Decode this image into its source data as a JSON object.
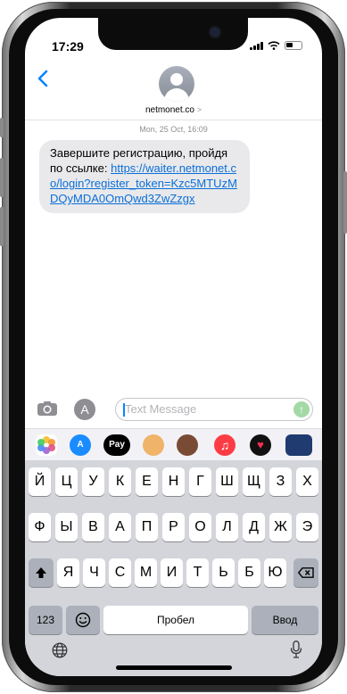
{
  "status_bar": {
    "time": "17:29"
  },
  "header": {
    "contact_name": "netmonet.co",
    "contact_chevron": ">",
    "back_icon": "chevron-left-icon"
  },
  "thread": {
    "date": "Mon, 25 Oct, 16:09",
    "message_text": "Завершите регистрацию, пройдя по ссылке: ",
    "message_link": "https://waiter.netmonet.co/login?register_token=Kzc5MTUzMDQyMDA0OmQwd3ZwZzgx"
  },
  "composer": {
    "placeholder": "Text Message",
    "camera_icon": "camera-icon",
    "apps_icon": "app-store-icon",
    "send_icon": "arrow-up-icon"
  },
  "app_drawer": {
    "apps": [
      {
        "name": "photos-icon",
        "label": "",
        "color": "#ffffff"
      },
      {
        "name": "app-store-icon",
        "label": "A",
        "color": "#1a8cff"
      },
      {
        "name": "apple-pay-icon",
        "label": "Pay",
        "color": "#000000"
      },
      {
        "name": "memoji-icon",
        "label": "",
        "color": "#f2a65a"
      },
      {
        "name": "animoji-icon",
        "label": "",
        "color": "#8b5a3c"
      },
      {
        "name": "music-icon",
        "label": "♫",
        "color": "#fc3c44"
      },
      {
        "name": "digital-touch-icon",
        "label": "♥",
        "color": "#111111"
      },
      {
        "name": "more-apps-icon",
        "label": "",
        "color": "#1f3b70"
      }
    ]
  },
  "keyboard": {
    "row1": [
      "Й",
      "Ц",
      "У",
      "К",
      "Е",
      "Н",
      "Г",
      "Ш",
      "Щ",
      "З",
      "Х"
    ],
    "row2": [
      "Ф",
      "Ы",
      "В",
      "А",
      "П",
      "Р",
      "О",
      "Л",
      "Д",
      "Ж",
      "Э"
    ],
    "row3": [
      "Я",
      "Ч",
      "С",
      "М",
      "И",
      "Т",
      "Ь",
      "Б",
      "Ю"
    ],
    "shift_icon": "shift-icon",
    "delete_icon": "delete-icon",
    "numbers_label": "123",
    "emoji_icon": "emoji-icon",
    "space_label": "Пробел",
    "return_label": "Ввод",
    "globe_icon": "globe-icon",
    "mic_icon": "microphone-icon"
  }
}
